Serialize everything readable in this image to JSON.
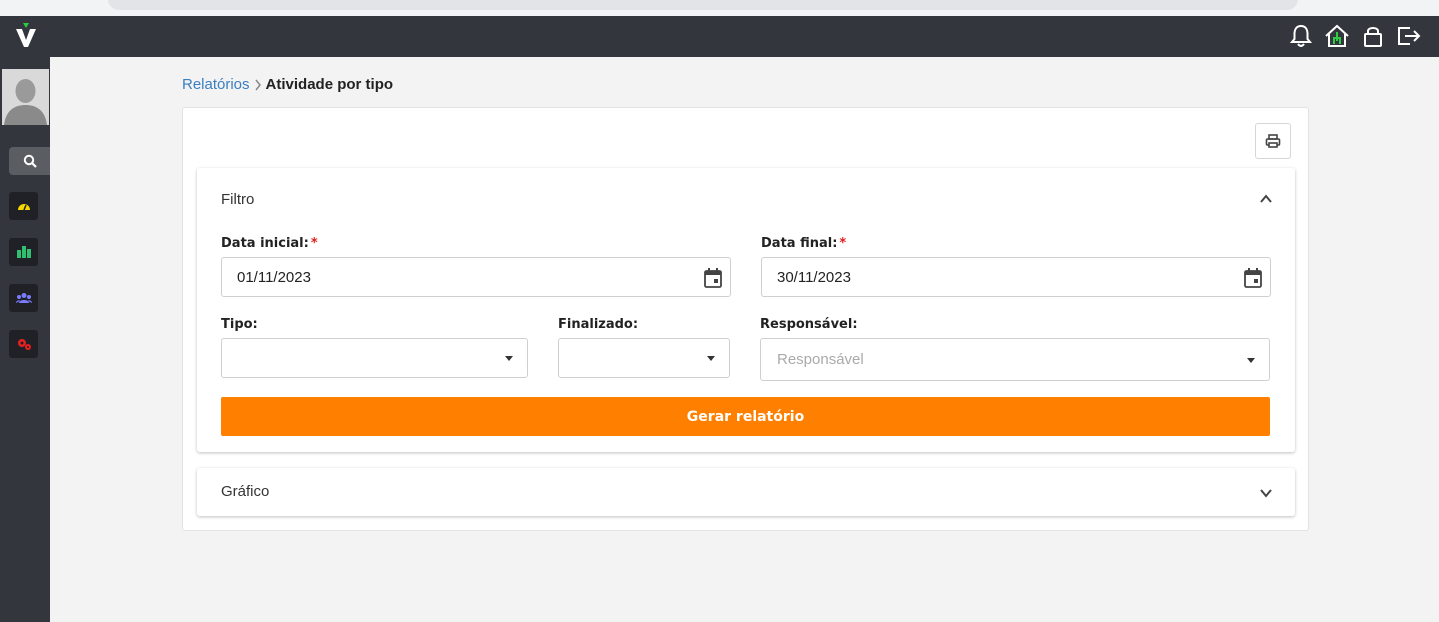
{
  "topbar": {
    "icons": [
      "bell-icon",
      "home-icon",
      "lock-icon",
      "logout-icon"
    ]
  },
  "sidebar": {
    "items": [
      "dashboard-icon",
      "building-icon",
      "users-icon",
      "gears-icon"
    ]
  },
  "breadcrumb": {
    "parent": "Relatórios",
    "separator": "›",
    "current": "Atividade por tipo"
  },
  "filter": {
    "title": "Filtro",
    "data_inicial_label": "Data inicial:",
    "data_inicial_value": "01/11/2023",
    "data_final_label": "Data final:",
    "data_final_value": "30/11/2023",
    "required_mark": "*",
    "tipo_label": "Tipo:",
    "tipo_value": "",
    "finalizado_label": "Finalizado:",
    "finalizado_value": "",
    "responsavel_label": "Responsável:",
    "responsavel_placeholder": "Responsável",
    "generate_button": "Gerar relatório"
  },
  "graph": {
    "title": "Gráfico"
  },
  "colors": {
    "topbar": "#33363d",
    "accent": "#ff8000",
    "link": "#3a7fc1",
    "required": "#e01b1b"
  }
}
